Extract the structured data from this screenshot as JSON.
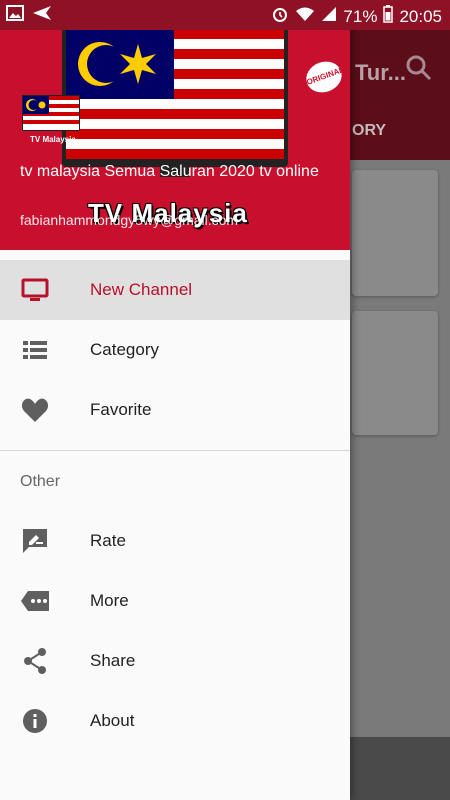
{
  "status_bar": {
    "battery": "71%",
    "time": "20:05"
  },
  "background": {
    "title": "Tur...",
    "tab_label": "ORY"
  },
  "drawer": {
    "header": {
      "title": "tv malaysia Semua Saluran 2020 tv online",
      "email": "fabianhammondgy5wy@gmail.com",
      "brand_text": "TV Malaysia",
      "logo_small_label": "TV Malaysia",
      "badge_text": "ORIGINAL"
    },
    "menu": [
      {
        "label": "New Channel",
        "icon": "tv-icon",
        "active": true
      },
      {
        "label": "Category",
        "icon": "list-icon",
        "active": false
      },
      {
        "label": "Favorite",
        "icon": "heart-icon",
        "active": false
      }
    ],
    "other_section": {
      "title": "Other",
      "items": [
        {
          "label": "Rate",
          "icon": "rate-icon"
        },
        {
          "label": "More",
          "icon": "more-icon"
        },
        {
          "label": "Share",
          "icon": "share-icon"
        },
        {
          "label": "About",
          "icon": "info-icon"
        }
      ]
    }
  },
  "colors": {
    "primary": "#c8102e",
    "status_bar": "#8e1126",
    "active_text": "#b7102a",
    "icon_gray": "#5f5f5f"
  }
}
